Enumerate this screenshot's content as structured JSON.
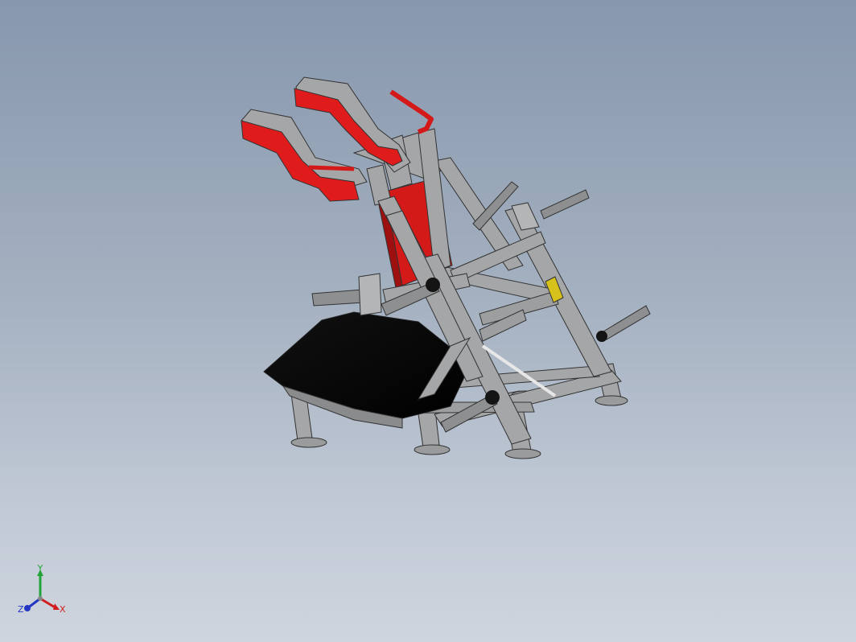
{
  "viewport": {
    "background_top": "#8797ad",
    "background_bottom": "#cfd5de"
  },
  "model": {
    "frame_color": "#a5a6a8",
    "frame_shadow": "#8a8b8d",
    "pad_color": "#e01b1b",
    "pad_shadow": "#9e1010",
    "platform_color": "#060606",
    "peg_color": "#8e8f91",
    "sleeve_color": "#141414",
    "label_color": "#d6c21a"
  },
  "triad": {
    "x_label": "X",
    "y_label": "Y",
    "z_label": "Z",
    "x_color": "#d11f1f",
    "y_color": "#22a33a",
    "z_color": "#2436c4"
  }
}
